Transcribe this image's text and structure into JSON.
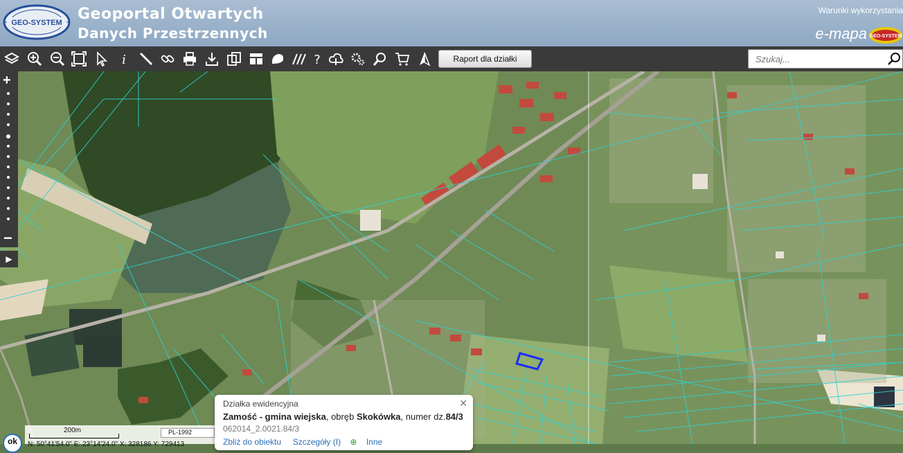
{
  "header": {
    "title_line1": "Geoportal Otwartych",
    "title_line2": "Danych Przestrzennych",
    "terms_link": "Warunki wykorzystania",
    "brand": "e-mapa",
    "logo_text": "GEO-SYSTEM",
    "brand_logo_text": "GEO-SYSTEM"
  },
  "toolbar": {
    "tools": [
      "layers-icon",
      "zoom-in-icon",
      "zoom-out-icon",
      "zoom-extent-icon",
      "pointer-icon",
      "info-icon",
      "measure-icon",
      "link-icon",
      "print-icon",
      "download-icon",
      "export-icon",
      "layout-icon",
      "shape-icon",
      "hatch-icon",
      "help-icon",
      "cloud-icon",
      "settings-icon",
      "search-map-icon",
      "cart-icon",
      "compass-icon"
    ],
    "raport_label": "Raport dla działki",
    "search_placeholder": "Szukaj..."
  },
  "scale": {
    "label": "200m",
    "crs": "PL-1992",
    "coords": "N: 50°41'54.0\"  E: 23°14'24.0\"  X: 328186  Y: 729413"
  },
  "ok_label": "ok",
  "popup": {
    "title": "Działka ewidencyjna",
    "place": "Zamość - gmina wiejska",
    "obreb_prefix": ", obręb ",
    "obreb": "Skokówka",
    "numer_prefix": ", numer dz.",
    "numer": "84/3",
    "id": "062014_2.0021.84/3",
    "link_zoom": "Zbliż do obiektu",
    "link_details": "Szczegóły (I)",
    "link_other": "Inne"
  },
  "colors": {
    "header_bg": "#98b0c9",
    "toolbar_bg": "#3a3a3a",
    "parcel_line": "#2fd0d0",
    "selected_parcel": "#1a2bff"
  }
}
